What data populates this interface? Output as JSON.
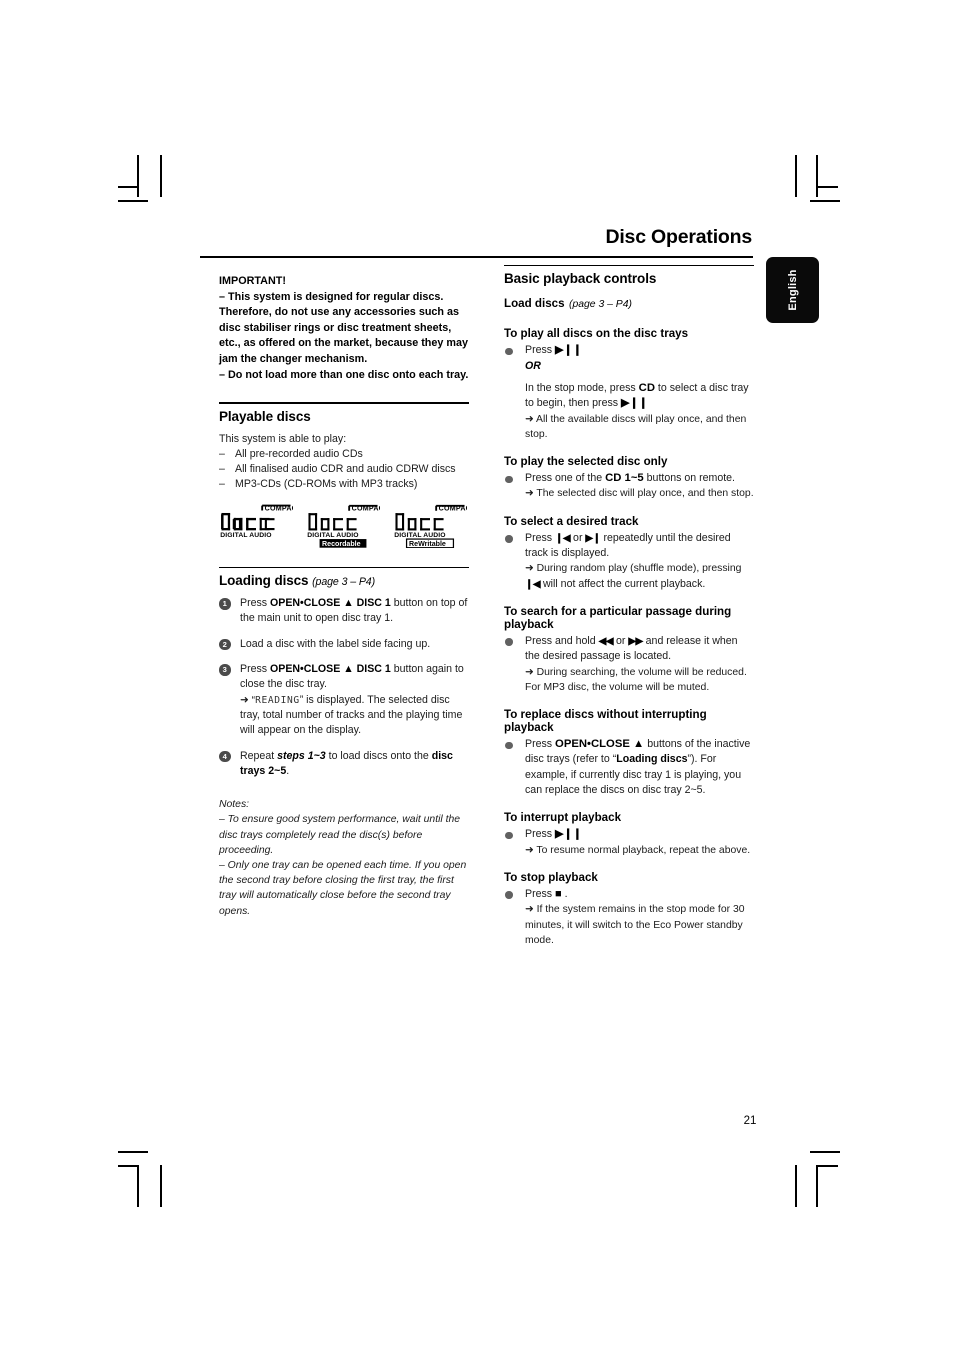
{
  "page": {
    "title": "Disc Operations",
    "language_tab": "English",
    "page_number": "21"
  },
  "left_column": {
    "important": {
      "heading": "IMPORTANT!",
      "lines": [
        "–  This system is designed for regular discs. Therefore, do not use any accessories such as disc stabiliser rings or disc treatment sheets, etc., as offered on the market, because they may jam the changer mechanism.",
        "–  Do not load more than one disc onto each tray."
      ]
    },
    "playable_discs": {
      "heading": "Playable discs",
      "intro": "This system is able to play:",
      "items": [
        "All pre-recorded audio CDs",
        "All finalised audio CDR and audio CDRW discs",
        "MP3-CDs (CD-ROMs with MP3 tracks)"
      ],
      "logos": [
        {
          "name": "compact-disc-digital-audio",
          "top": "COMPACT",
          "word": "disc",
          "bottom": "DIGITAL AUDIO",
          "badge": "",
          "badge_style": "none"
        },
        {
          "name": "compact-disc-recordable",
          "top": "COMPACT",
          "word": "disc",
          "bottom": "DIGITAL AUDIO",
          "badge": "Recordable",
          "badge_style": "inverted"
        },
        {
          "name": "compact-disc-rewritable",
          "top": "COMPACT",
          "word": "disc",
          "bottom": "DIGITAL AUDIO",
          "badge": "ReWritable",
          "badge_style": "outline"
        }
      ]
    },
    "loading_discs": {
      "heading": "Loading discs",
      "heading_ref": "(page 3 – P4)",
      "steps": [
        {
          "num": "1",
          "text_pre": "Press ",
          "bold": "OPEN•CLOSE ▲ DISC 1",
          "text_post": " button on top of the main unit to open disc tray 1."
        },
        {
          "num": "2",
          "text_pre": "Load a disc with the label side facing up.",
          "bold": "",
          "text_post": ""
        },
        {
          "num": "3",
          "text_pre": "Press ",
          "bold": "OPEN•CLOSE ▲ DISC 1",
          "text_post": " button again to close the disc tray.",
          "arrow_pre": "➜ “",
          "arrow_lcd": "READING",
          "arrow_post": "” is displayed. The selected disc tray, total number of tracks and the playing time will appear on the display."
        },
        {
          "num": "4",
          "text_pre": "Repeat ",
          "bold": "steps 1~3",
          "text_mid": " to load discs onto the ",
          "bold2": "disc trays 2~5",
          "text_post": "."
        }
      ],
      "notes_label": "Notes:",
      "notes": [
        "–  To ensure good system performance, wait until the disc trays completely read the disc(s) before proceeding.",
        "–  Only one tray can be opened each time. If you open the second tray before closing the first tray, the first tray will automatically close before the second tray opens."
      ]
    }
  },
  "right_column": {
    "heading": "Basic playback controls",
    "load_discs_label": "Load discs",
    "load_discs_ref": "(page 3 – P4)",
    "sections": [
      {
        "title": "To play all discs on the disc trays",
        "bullet_pre": "Press ",
        "bullet_glyph": "▶❙❙",
        "or_label": "OR",
        "body_a_pre": "In the stop mode, press ",
        "body_a_bold": "CD",
        "body_a_mid": " to select a disc tray to begin, then press ",
        "body_a_glyph": "▶❙❙",
        "arrow_text": "➜ All the available discs will play once, and then stop."
      },
      {
        "title": "To play the selected disc only",
        "bullet_pre": "Press one of the ",
        "bullet_bold": "CD 1~5",
        "bullet_post": " buttons on remote.",
        "arrow_text": "➜ The selected disc will play once, and then stop."
      },
      {
        "title": "To select a desired track",
        "bullet_pre": "Press ",
        "glyph_prev": "❙◀",
        "bullet_mid": " or ",
        "glyph_next": "▶❙",
        "bullet_post": " repeatedly until the desired track is displayed.",
        "arrow_pre": "➜ During random play (shuffle mode), pressing ",
        "arrow_glyph": "❙◀",
        "arrow_post": " will not affect the current playback."
      },
      {
        "title": "To search for a particular passage during playback",
        "bullet_pre": "Press and hold ",
        "glyph_rew": "◀◀",
        "bullet_mid": " or ",
        "glyph_ff": "▶▶",
        "bullet_post": " and release it when the desired passage is located.",
        "arrow_text": "➜ During searching, the volume will be reduced. For MP3 disc, the volume will be muted."
      },
      {
        "title": "To replace discs without interrupting playback",
        "bullet_pre": "Press ",
        "bullet_bold": "OPEN•CLOSE ▲",
        "bullet_mid": " buttons of the inactive disc trays (refer to “",
        "bullet_bold2": "Loading discs",
        "bullet_post": "”). For example, if currently disc tray 1 is playing, you can replace the discs on disc tray 2~5."
      },
      {
        "title": "To interrupt playback",
        "bullet_pre": "Press ",
        "bullet_glyph": "▶❙❙",
        "arrow_text": "➜ To resume normal playback, repeat the above."
      },
      {
        "title": "To stop playback",
        "bullet_pre": "Press ",
        "bullet_glyph": "■",
        "bullet_post": " .",
        "arrow_text": "➜ If the system remains in the stop mode for 30 minutes, it will switch to the Eco Power standby mode."
      }
    ]
  }
}
